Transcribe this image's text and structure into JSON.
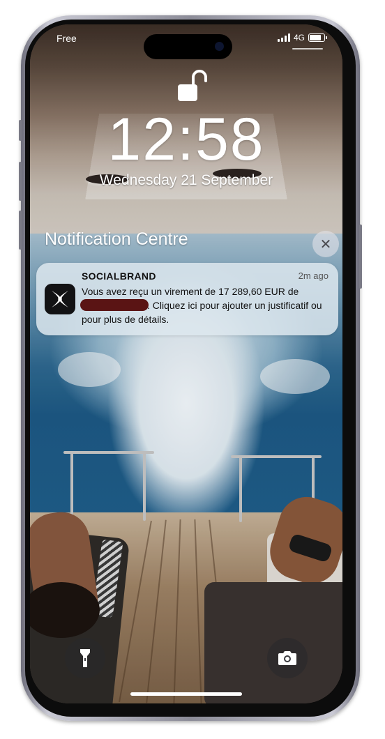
{
  "status_bar": {
    "carrier": "Free",
    "network": "4G"
  },
  "lock_screen": {
    "time": "12:58",
    "date": "Wednesday 21 September"
  },
  "notification_centre": {
    "title": "Notification Centre",
    "close_glyph": "✕"
  },
  "notification": {
    "app_name": "SOCIALBRAND",
    "time_ago": "2m ago",
    "body_part1": "Vous avez reçu un virement de 17 289,60 EUR de",
    "body_part2": ". Cliquez ici pour ajouter un justificatif ou pour plus de détails.",
    "icon": "socialbrand-x-logo"
  },
  "quick_actions": {
    "left_icon": "flashlight-icon",
    "right_icon": "camera-icon"
  },
  "colors": {
    "notification_bg": "#dce6ee",
    "redaction": "#5a1414",
    "text_white": "#ffffff"
  }
}
